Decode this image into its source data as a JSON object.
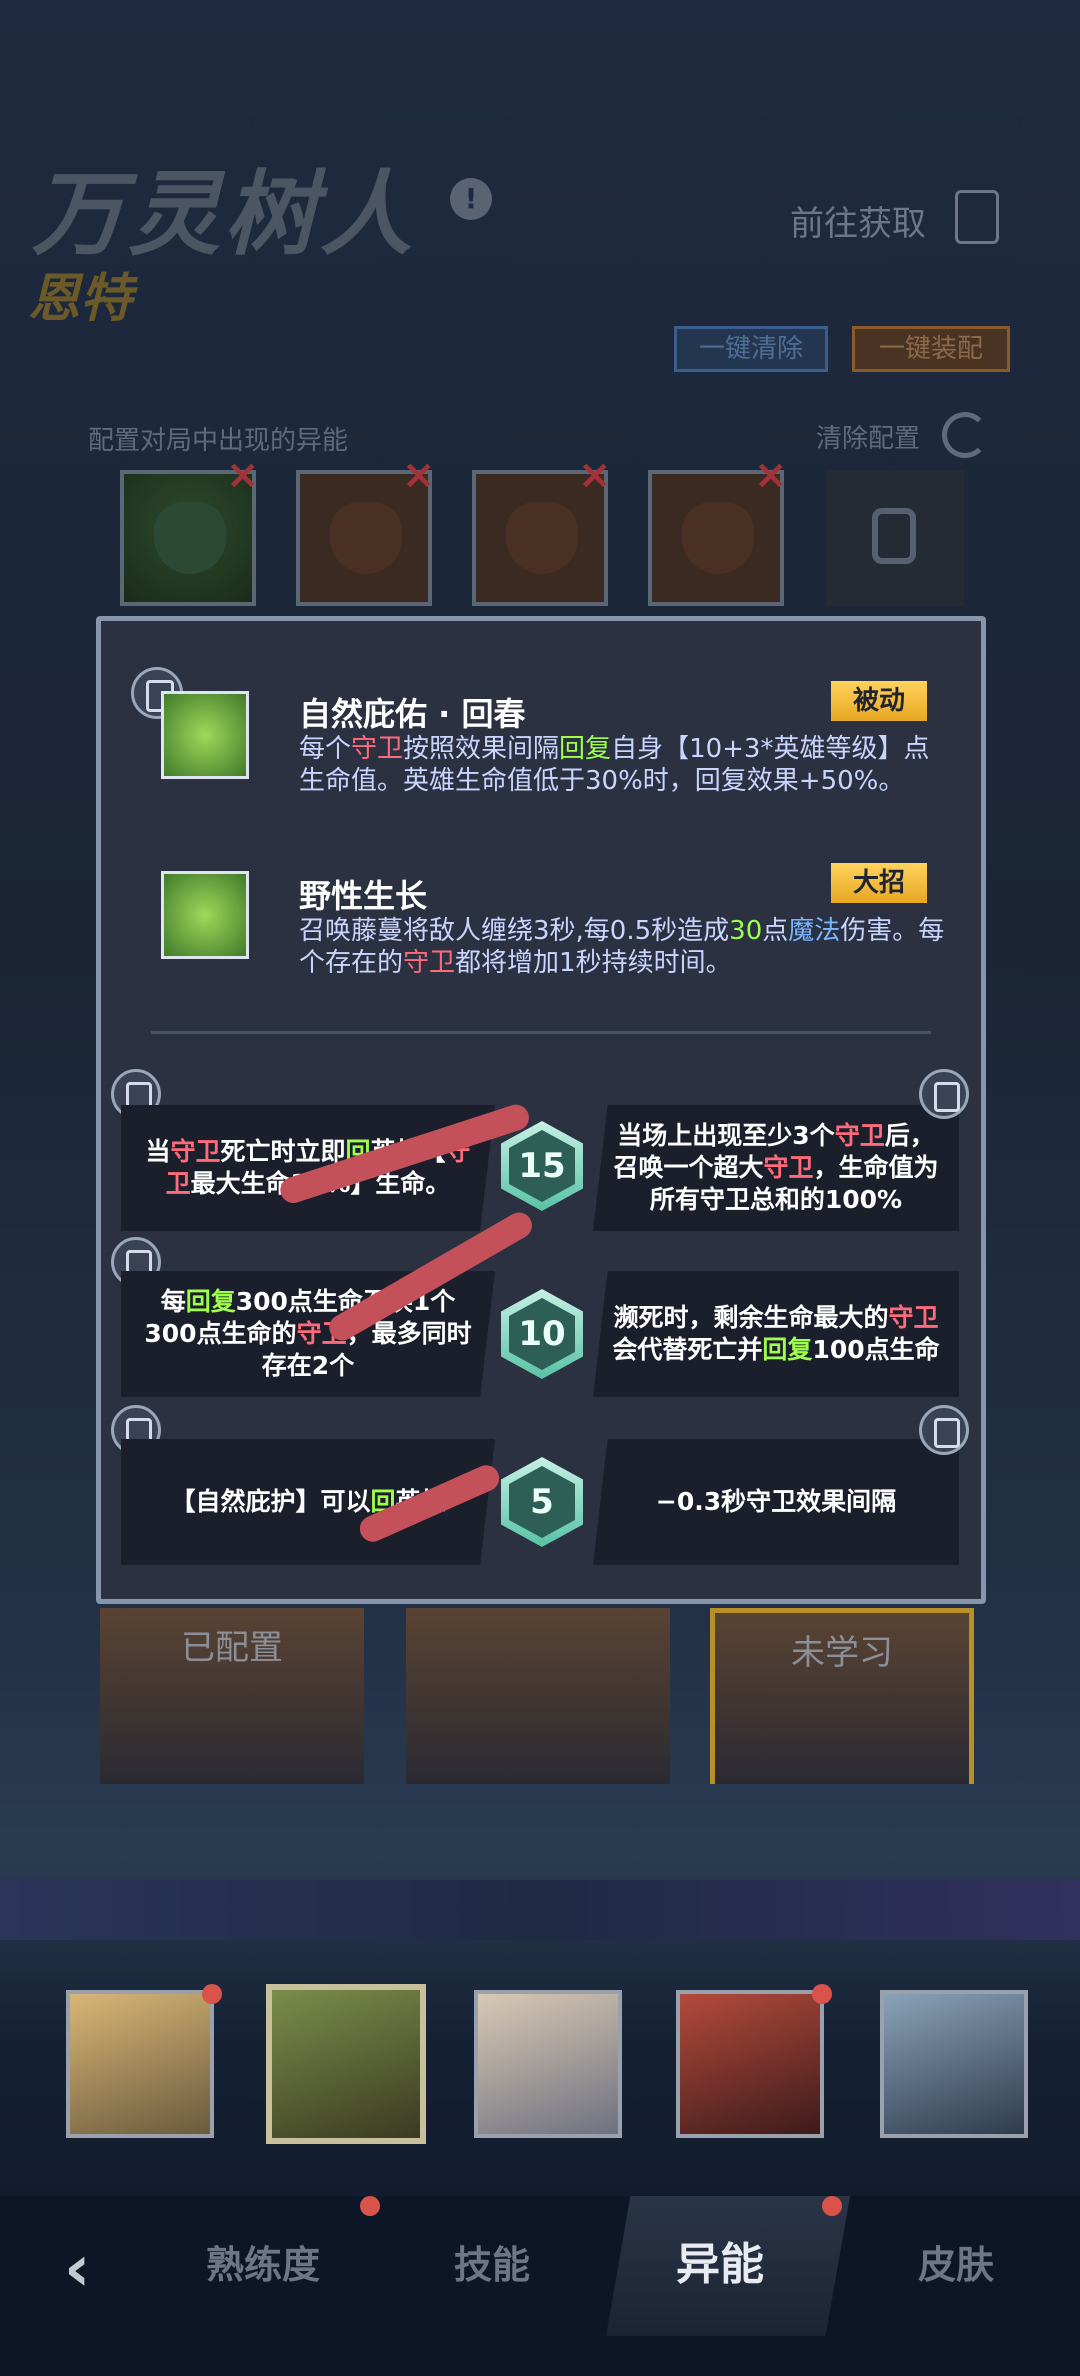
{
  "header": {
    "hero_name": "万灵树人",
    "hero_subname": "恩特",
    "goto_label": "前往获取",
    "btn_clear_all": "一键清除",
    "btn_equip_all": "一键装配"
  },
  "config": {
    "label": "配置对局中出现的异能",
    "clear_label": "清除配置"
  },
  "skills": [
    {
      "title": "自然庇佑 · 回春",
      "tag": "被动",
      "desc_parts": [
        {
          "t": "每个",
          "c": ""
        },
        {
          "t": "守卫",
          "c": "red"
        },
        {
          "t": "按照效果间隔",
          "c": ""
        },
        {
          "t": "回复",
          "c": "green"
        },
        {
          "t": "自身【10+3*英雄等级】点生命值。英雄生命值低于30%时，回复效果+50%。",
          "c": ""
        }
      ]
    },
    {
      "title": "野性生长",
      "tag": "大招",
      "desc_parts": [
        {
          "t": "召唤藤蔓将敌人缠绕3秒,每0.5秒造成",
          "c": ""
        },
        {
          "t": "30",
          "c": "green"
        },
        {
          "t": "点",
          "c": ""
        },
        {
          "t": "魔法",
          "c": "blue"
        },
        {
          "t": "伤害。每个存在的",
          "c": ""
        },
        {
          "t": "守卫",
          "c": "red"
        },
        {
          "t": "都将增加1秒持续时间。",
          "c": ""
        }
      ]
    }
  ],
  "talents": [
    {
      "level": "15",
      "left_parts": [
        {
          "t": "当",
          "c": ""
        },
        {
          "t": "守卫",
          "c": "red"
        },
        {
          "t": "死亡时立即",
          "c": ""
        },
        {
          "t": "回",
          "c": "green"
        },
        {
          "t": "英雄【",
          "c": ""
        },
        {
          "t": "守卫",
          "c": "red"
        },
        {
          "t": "最大生命",
          "c": ""
        },
        {
          "t": "30%】生命。",
          "c": ""
        }
      ],
      "right_parts": [
        {
          "t": "当场上出现至少3个",
          "c": ""
        },
        {
          "t": "守卫",
          "c": "red"
        },
        {
          "t": "后，召唤一个超大",
          "c": ""
        },
        {
          "t": "守卫",
          "c": "red"
        },
        {
          "t": "，生命值为所有守卫总和的100%",
          "c": ""
        }
      ]
    },
    {
      "level": "10",
      "left_parts": [
        {
          "t": "每",
          "c": ""
        },
        {
          "t": "回复",
          "c": "green"
        },
        {
          "t": "300点生命",
          "c": ""
        },
        {
          "t": "召唤1个300点生命的",
          "c": ""
        },
        {
          "t": "守卫",
          "c": "red"
        },
        {
          "t": "，最多同时存在2个",
          "c": ""
        }
      ],
      "right_parts": [
        {
          "t": "濒死时，剩余生命最大的",
          "c": ""
        },
        {
          "t": "守卫",
          "c": "red"
        },
        {
          "t": "会代替死亡并",
          "c": ""
        },
        {
          "t": "回复",
          "c": "green"
        },
        {
          "t": "100点生命",
          "c": ""
        }
      ]
    },
    {
      "level": "5",
      "left_parts": [
        {
          "t": "【自然庇护】可以",
          "c": ""
        },
        {
          "t": "回",
          "c": "green"
        },
        {
          "t": "英雄",
          "c": ""
        }
      ],
      "right_parts": [
        {
          "t": "−0.3秒守卫效果间隔",
          "c": ""
        }
      ]
    }
  ],
  "cards": [
    {
      "label": "已配置"
    },
    {
      "label": ""
    },
    {
      "label": "未学习"
    }
  ],
  "nav": {
    "tabs": [
      "熟练度",
      "技能",
      "异能",
      "皮肤"
    ],
    "active": "异能"
  },
  "colors": {
    "highlight_red": "#ff6b7b",
    "highlight_green": "#9dff4c",
    "highlight_blue": "#7ab6ff",
    "tag_gold": "#ffc23a"
  }
}
